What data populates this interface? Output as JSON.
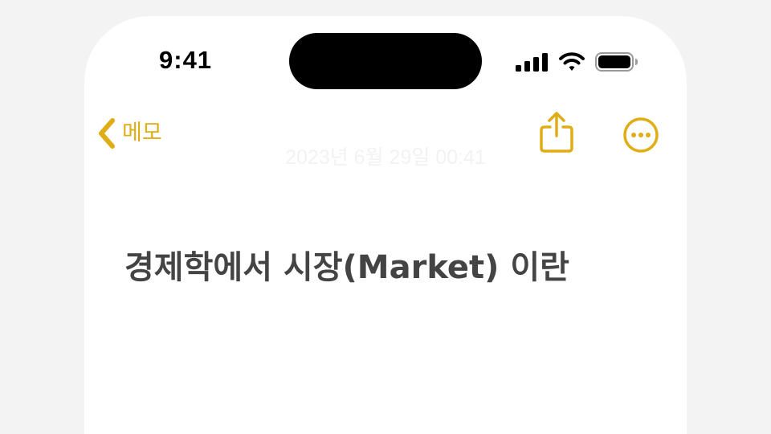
{
  "status_bar": {
    "time": "9:41",
    "signal_icon": "cellular-signal-icon",
    "wifi_icon": "wifi-icon",
    "battery_icon": "battery-full-icon"
  },
  "nav": {
    "back_label": "메모",
    "back_icon": "chevron-left-icon",
    "share_icon": "share-icon",
    "more_icon": "more-ellipsis-circle-icon"
  },
  "note": {
    "date": "2023년 6월 29일 00:41",
    "title": "경제학에서 시장(Market) 이란"
  },
  "colors": {
    "accent": "#e0ad16",
    "title_text": "#444444",
    "background": "#ffffff",
    "outer_background": "#f3f3f3"
  }
}
